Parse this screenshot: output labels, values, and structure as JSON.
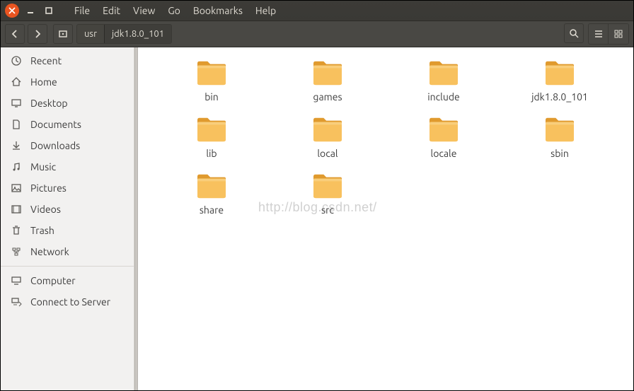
{
  "menu": {
    "items": [
      "File",
      "Edit",
      "View",
      "Go",
      "Bookmarks",
      "Help"
    ]
  },
  "path": {
    "segments": [
      "usr",
      "jdk1.8.0_101"
    ]
  },
  "sidebar": {
    "items": [
      {
        "label": "Recent",
        "icon": "clock"
      },
      {
        "label": "Home",
        "icon": "home"
      },
      {
        "label": "Desktop",
        "icon": "desktop"
      },
      {
        "label": "Documents",
        "icon": "documents"
      },
      {
        "label": "Downloads",
        "icon": "download"
      },
      {
        "label": "Music",
        "icon": "music"
      },
      {
        "label": "Pictures",
        "icon": "pictures"
      },
      {
        "label": "Videos",
        "icon": "video"
      },
      {
        "label": "Trash",
        "icon": "trash"
      },
      {
        "label": "Network",
        "icon": "network"
      }
    ],
    "items2": [
      {
        "label": "Computer",
        "icon": "computer"
      },
      {
        "label": "Connect to Server",
        "icon": "server"
      }
    ]
  },
  "folders": [
    "bin",
    "games",
    "include",
    "jdk1.8.0_101",
    "lib",
    "local",
    "locale",
    "sbin",
    "share",
    "src"
  ],
  "watermark": "http://blog.csdn.net/"
}
